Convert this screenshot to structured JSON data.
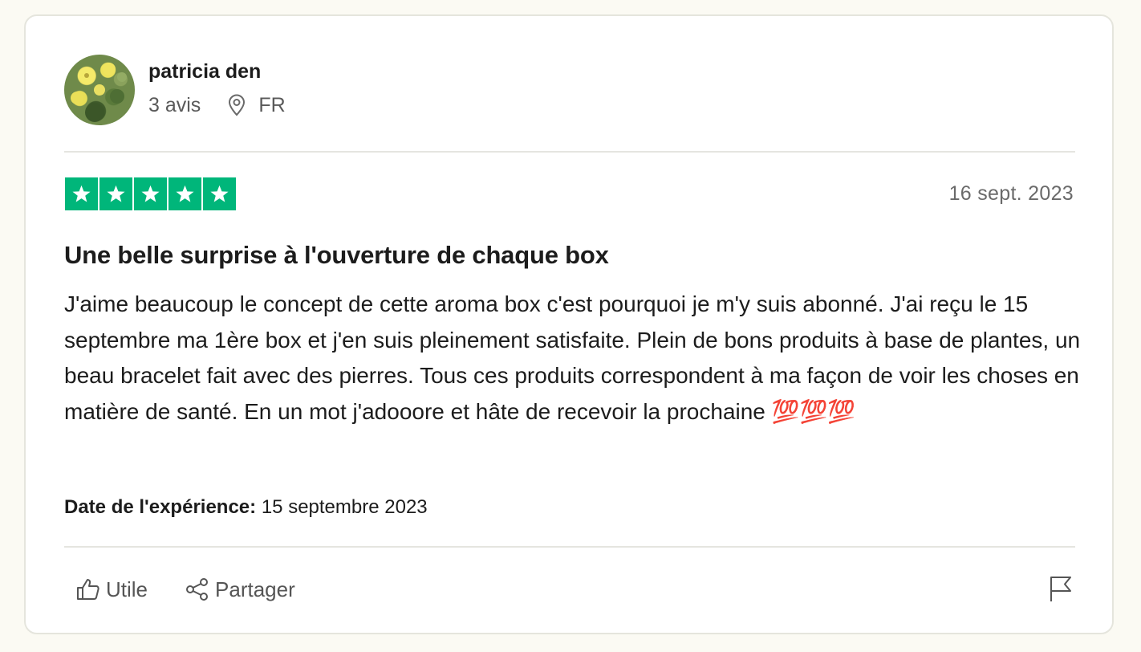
{
  "reviewer": {
    "name": "patricia den",
    "review_count": "3 avis",
    "country": "FR"
  },
  "review": {
    "rating": 5,
    "date": "16 sept. 2023",
    "title": "Une belle surprise à l'ouverture de chaque box",
    "body": "J'aime beaucoup le concept de cette aroma box c'est pourquoi je m'y suis abonné. J'ai reçu le 15 septembre ma 1ère box et j'en suis pleinement satisfaite. Plein de bons produits à base de plantes, un beau bracelet fait avec des pierres. Tous ces produits correspondent à ma façon de voir les choses en matière de santé. En un mot j'adooore et hâte de recevoir la prochaine 💯💯💯",
    "experience_label": "Date de l'expérience:",
    "experience_date": "15 septembre 2023"
  },
  "actions": {
    "useful_label": "Utile",
    "share_label": "Partager"
  },
  "colors": {
    "star_green": "#00b67a",
    "page_background": "#fbfaf3"
  },
  "icons": [
    "location-pin-icon",
    "star-icon",
    "thumbs-up-icon",
    "share-icon",
    "flag-icon"
  ]
}
